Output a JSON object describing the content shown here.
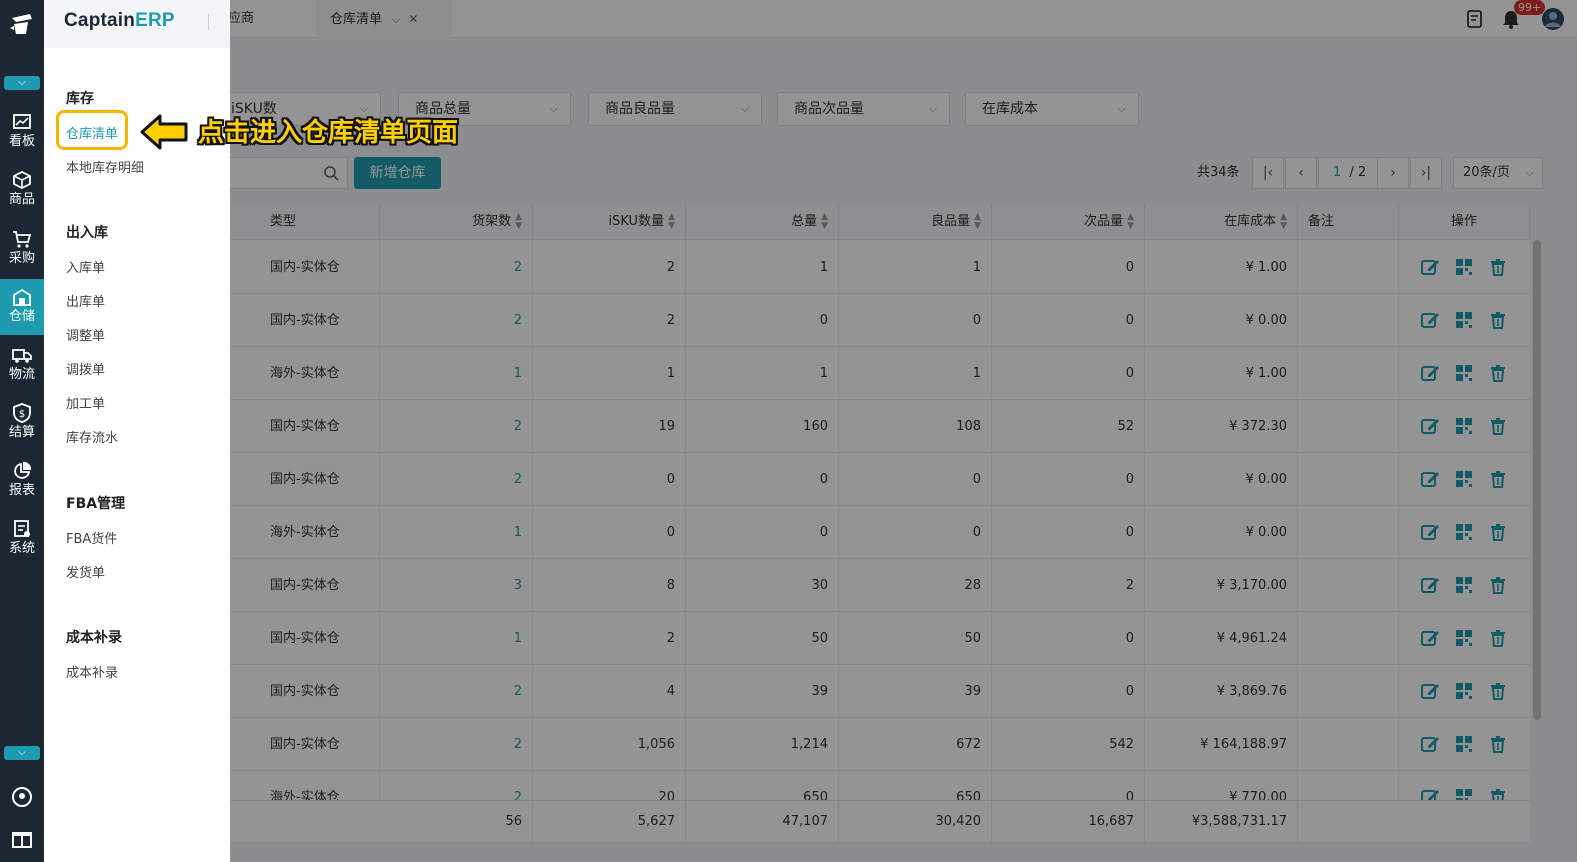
{
  "brand": {
    "name_a": "Captain",
    "name_b": "ERP"
  },
  "rail": {
    "items": [
      {
        "label": "看板",
        "icon": "chart-board-icon"
      },
      {
        "label": "商品",
        "icon": "box-icon"
      },
      {
        "label": "采购",
        "icon": "cart-icon"
      },
      {
        "label": "仓储",
        "icon": "warehouse-icon"
      },
      {
        "label": "物流",
        "icon": "truck-icon"
      },
      {
        "label": "结算",
        "icon": "dollar-shield-icon"
      },
      {
        "label": "报表",
        "icon": "pie-chart-icon"
      },
      {
        "label": "系统",
        "icon": "system-icon"
      }
    ]
  },
  "menu": {
    "groups": [
      {
        "title": "库存",
        "items": [
          "仓库清单",
          "本地库存明细"
        ]
      },
      {
        "title": "出入库",
        "items": [
          "入库单",
          "出库单",
          "调整单",
          "调拨单",
          "加工单",
          "库存流水"
        ]
      },
      {
        "title": "FBA管理",
        "items": [
          "FBA货件",
          "发货单"
        ]
      },
      {
        "title": "成本补录",
        "items": [
          "成本补录"
        ]
      }
    ]
  },
  "annotation": "点击进入仓库清单页面",
  "tabs": {
    "partial": "应商",
    "active": "仓库清单"
  },
  "notifications": {
    "badge": "99+"
  },
  "filters": [
    "iSKU数",
    "商品总量",
    "商品良品量",
    "商品次品量",
    "在库成本"
  ],
  "toolbar": {
    "add_label": "新增仓库"
  },
  "pager": {
    "total": "共34条",
    "current": "1",
    "pages": "/ 2",
    "size": "20条/页"
  },
  "table": {
    "headers": [
      "类型",
      "货架数",
      "iSKU数量",
      "总量",
      "良品量",
      "次品量",
      "在库成本",
      "备注",
      "操作"
    ],
    "rows": [
      [
        "国内-实体仓",
        "2",
        "2",
        "1",
        "1",
        "0",
        "¥ 1.00"
      ],
      [
        "国内-实体仓",
        "2",
        "2",
        "0",
        "0",
        "0",
        "¥ 0.00"
      ],
      [
        "海外-实体仓",
        "1",
        "1",
        "1",
        "1",
        "0",
        "¥ 1.00"
      ],
      [
        "国内-实体仓",
        "2",
        "19",
        "160",
        "108",
        "52",
        "¥ 372.30"
      ],
      [
        "国内-实体仓",
        "2",
        "0",
        "0",
        "0",
        "0",
        "¥ 0.00"
      ],
      [
        "海外-实体仓",
        "1",
        "0",
        "0",
        "0",
        "0",
        "¥ 0.00"
      ],
      [
        "国内-实体仓",
        "3",
        "8",
        "30",
        "28",
        "2",
        "¥ 3,170.00"
      ],
      [
        "国内-实体仓",
        "1",
        "2",
        "50",
        "50",
        "0",
        "¥ 4,961.24"
      ],
      [
        "国内-实体仓",
        "2",
        "4",
        "39",
        "39",
        "0",
        "¥ 3,869.76"
      ],
      [
        "国内-实体仓",
        "2",
        "1,056",
        "1,214",
        "672",
        "542",
        "¥ 164,188.97"
      ],
      [
        "海外-实体仓",
        "2",
        "20",
        "650",
        "650",
        "0",
        "¥ 770.00"
      ]
    ],
    "totals": [
      "56",
      "5,627",
      "47,107",
      "30,420",
      "16,687",
      "¥3,588,731.17"
    ]
  },
  "colors": {
    "accent": "#1f9bb0",
    "rail": "#1d2733",
    "highlight": "#f7b500",
    "annotation": "#ffd000"
  }
}
